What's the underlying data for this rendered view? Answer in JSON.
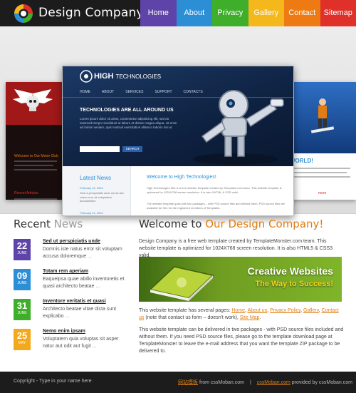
{
  "header": {
    "brand": "Design Company",
    "nav": [
      {
        "label": "Home",
        "color": "#5e44a8"
      },
      {
        "label": "About",
        "color": "#2c8fd6"
      },
      {
        "label": "Privacy",
        "color": "#3fae2a"
      },
      {
        "label": "Gallery",
        "color": "#f4b81c"
      },
      {
        "label": "Contact",
        "color": "#ed7a12"
      },
      {
        "label": "Sitemap",
        "color": "#e0302a"
      }
    ]
  },
  "showcase": {
    "main": {
      "logo_main": "HIGH",
      "logo_rest": "TECHNOLOGIES",
      "nav": [
        "HOME",
        "ABOUT",
        "SERVICES",
        "SUPPORT",
        "CONTACTS"
      ],
      "slogan": "TECHNOLOGIES ARE ALL AROUND US",
      "intro": "Lorem ipsum dolor sit amet, consectetur adipisicing elit, sed do eiusmod tempor incididunt ut labore et dolore magna aliqua. Ut enim ad minim veniam, quis nostrud exercitation ullamco laboris nisi ut",
      "search_button": "SEARCH",
      "news_heading": "Latest News",
      "news_date": "February 15, 2010",
      "news_text": "Sed ut perspiciatis unde omnis iste natus error sit voluptatem accusantium",
      "news_date2": "February 21, 2010",
      "welcome_heading": "Welcome to High Technologies!",
      "welcome_text": "High Technologies Site is a free website template created by Templates.com team. This website template is optimized for 1024X768 screen resolution. It is also XHTML & CSS valid.",
      "welcome_text2": "The website template goes with two packages – with PSD source files and without them. PSD source files are available for free for the registered members of Templates."
    },
    "left": {
      "welcome": "Welcome to Our Motor Club",
      "recent": "Recent Articles"
    },
    "right": {
      "world": "WORLD!",
      "more": "more"
    }
  },
  "news": {
    "heading_main": "Recent",
    "heading_accent": "News",
    "items": [
      {
        "day": "22",
        "month": "JUNE",
        "color": "#5e44a8",
        "title": "Sed ut perspiciatis unde",
        "text": "Domnis iste natus error sit voluptam accusa doloremque",
        "more": "..."
      },
      {
        "day": "09",
        "month": "JUNE",
        "color": "#2c8fd6",
        "title": "Totam rem aperiam",
        "text": "Eaqueipsa quae abillo inventoretis et quasi architecto beatae",
        "more": "..."
      },
      {
        "day": "31",
        "month": "JUNE",
        "color": "#3fae2a",
        "title": "Inventore veritatis et quasi",
        "text": "Architecto beatae vitae dicta sunt explicabo",
        "more": "..."
      },
      {
        "day": "25",
        "month": "MAY",
        "color": "#f4a81c",
        "title": "Nemo enim ipsam",
        "text": "Voluptatem quia voluptas sit asper natur aut odit aut fugit",
        "more": "..."
      }
    ]
  },
  "welcome": {
    "heading_main": "Welcome to",
    "heading_accent": "Our Design Company!",
    "intro": "Design Company is a free web template created by TemplateMonster.com team. This website template is optimized for 1024X768 screen resolution. It is also HTML5 & CSS3 valid.",
    "banner_title": "Creative Websites",
    "banner_sub": "The Way to Success!",
    "pages_lead": "This website template has several pages:",
    "pages": [
      "Home",
      "About us",
      "Privacy Policy",
      "Gallery",
      "Contact us"
    ],
    "pages_note": "(note that contact us form – doesn't work),",
    "sitemap": "Site Map",
    "packages": "This website template can be delivered in two packages - with PSD source files included and without them. If you need PSD source files, please go to the template download page at TemplateMonster to leave the e-mail address that you want the template ZIP package to be delivered to."
  },
  "footer": {
    "copyright": "Copyright - Type in your name here",
    "credit_link1": "网站模板",
    "credit_from": "from cssMoban.com",
    "credit_sep": "|",
    "credit_link2": "cssMoban.com",
    "credit_tail": "provided by cssMoban.com"
  }
}
